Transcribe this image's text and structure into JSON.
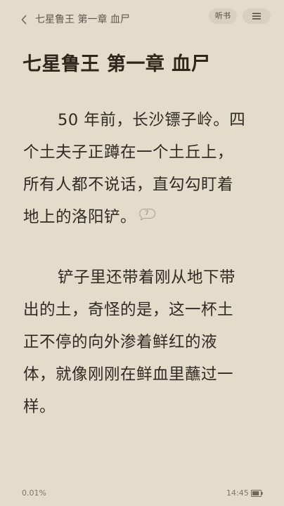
{
  "header": {
    "title": "七星鲁王 第一章 血尸",
    "listen_label": "听书"
  },
  "chapter": {
    "title": "七星鲁王 第一章 血尸",
    "paragraphs": [
      {
        "lines": [
          "50 年前，长沙镖子岭。四",
          "个土夫子正蹲在一个土丘上，",
          "所有人都不说话，直勾勾盯着",
          "地上的洛阳铲。"
        ],
        "comment_count": "7"
      },
      {
        "lines": [
          "铲子里还带着刚从地下带",
          "出的土，奇怪的是，这一杯土",
          "正不停的向外渗着鲜红的液",
          "体，就像刚刚在鲜血里蘸过一",
          "样。"
        ]
      }
    ]
  },
  "footer": {
    "progress": "0.01%",
    "time": "14:45",
    "battery_level": 0.85
  },
  "colors": {
    "background": "#e3dccb",
    "pill": "#d7d0bf",
    "text": "#2f2a22"
  },
  "icons": {
    "back": "chevron-left-icon",
    "menu": "menu-icon",
    "comment": "comment-bubble-icon",
    "battery": "battery-icon"
  }
}
